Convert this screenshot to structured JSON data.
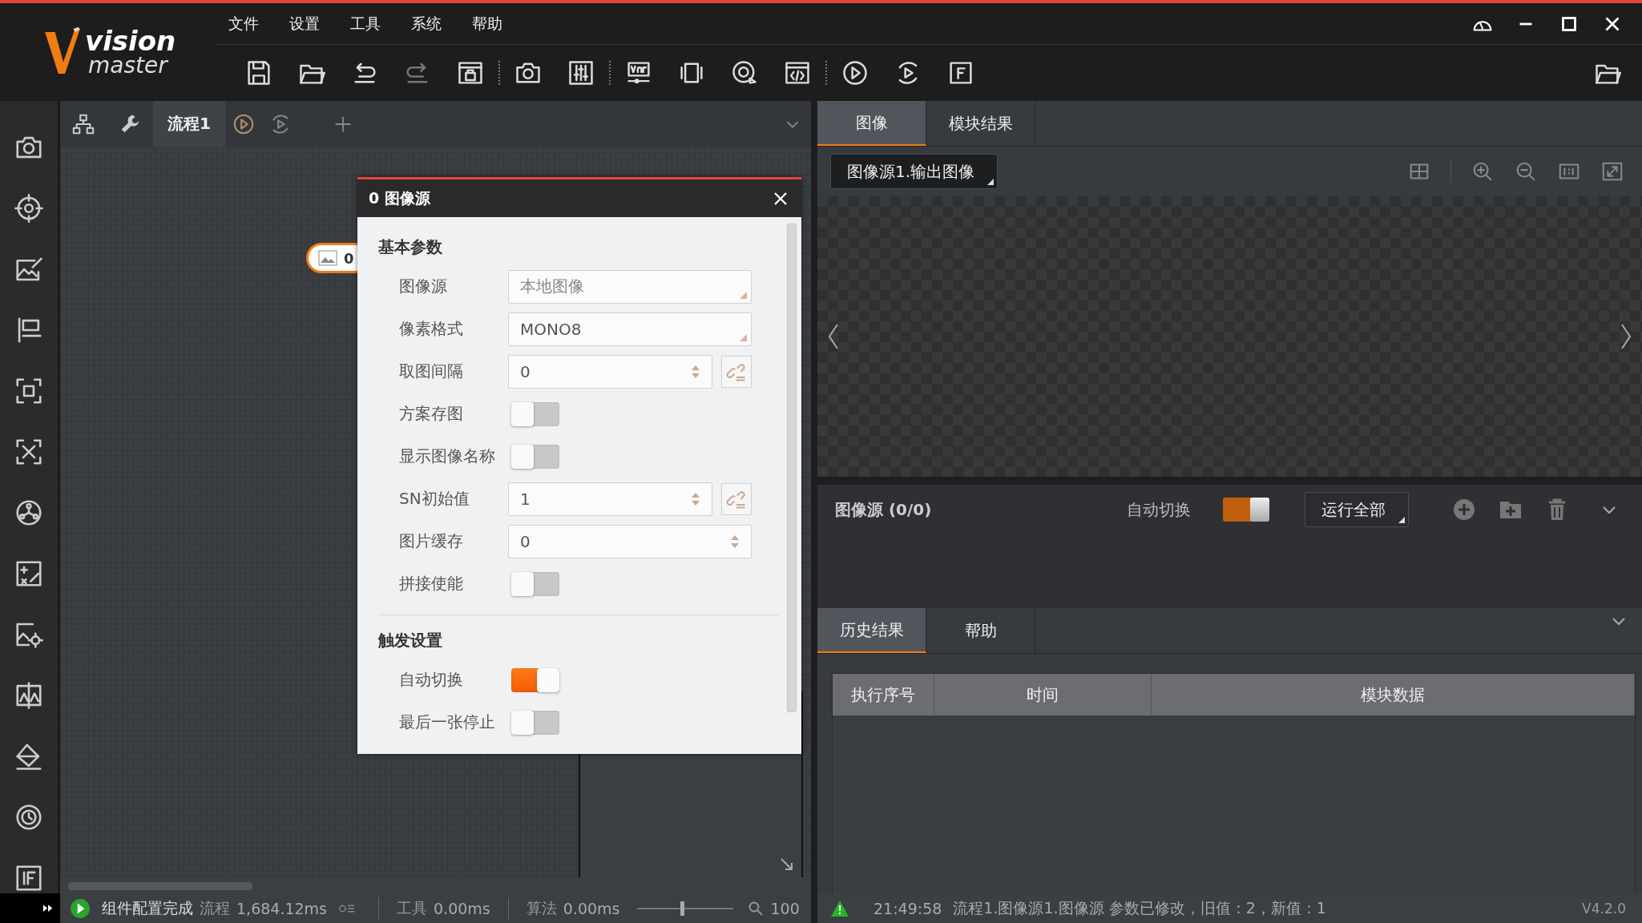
{
  "logo": {
    "top": "vision",
    "bottom": "master"
  },
  "menu": [
    "文件",
    "设置",
    "工具",
    "系统",
    "帮助"
  ],
  "flow_tabs": [
    {
      "label": "流程1",
      "selected": true
    }
  ],
  "node": {
    "label": "0"
  },
  "dialog": {
    "title": "0 图像源",
    "sections": [
      {
        "title": "基本参数",
        "rows": [
          {
            "kind": "select",
            "label": "图像源",
            "value": "本地图像",
            "placeholder_style": true
          },
          {
            "kind": "select",
            "label": "像素格式",
            "value": "MONO8",
            "placeholder_style": false
          },
          {
            "kind": "spin",
            "label": "取图间隔",
            "value": "0",
            "link": true
          },
          {
            "kind": "toggle",
            "label": "方案存图",
            "on": false
          },
          {
            "kind": "toggle",
            "label": "显示图像名称",
            "on": false
          },
          {
            "kind": "spin",
            "label": "SN初始值",
            "value": "1",
            "link": true
          },
          {
            "kind": "spin",
            "label": "图片缓存",
            "value": "0",
            "link": false
          },
          {
            "kind": "toggle",
            "label": "拼接使能",
            "on": false
          }
        ]
      },
      {
        "title": "触发设置",
        "rows": [
          {
            "kind": "toggle",
            "label": "自动切换",
            "on": true
          },
          {
            "kind": "toggle",
            "label": "最后一张停止",
            "on": false
          }
        ]
      }
    ]
  },
  "image_panel": {
    "tabs": [
      {
        "label": "图像",
        "selected": true
      },
      {
        "label": "模块结果",
        "selected": false
      }
    ],
    "source_select": "图像源1.输出图像",
    "source_bar": {
      "title": "图像源 (0/0)",
      "auto_label": "自动切换",
      "auto_on": true,
      "run_select": "运行全部"
    }
  },
  "history": {
    "tabs": [
      {
        "label": "历史结果",
        "selected": true
      },
      {
        "label": "帮助",
        "selected": false
      }
    ],
    "columns": [
      "执行序号",
      "时间",
      "模块数据"
    ]
  },
  "status": {
    "message": "组件配置完成",
    "flow_label": "流程",
    "flow_time": "1,684.12ms",
    "tool_label": "工具",
    "tool_time": "0.00ms",
    "algo_label": "算法",
    "algo_time": "0.00ms",
    "zoom": {
      "level": 0.46
    },
    "zoom_value": "100",
    "log_time": "21:49:58",
    "log_text": "流程1.图像源1.图像源 参数已修改，旧值：2，新值：1",
    "version": "V4.2.0"
  }
}
